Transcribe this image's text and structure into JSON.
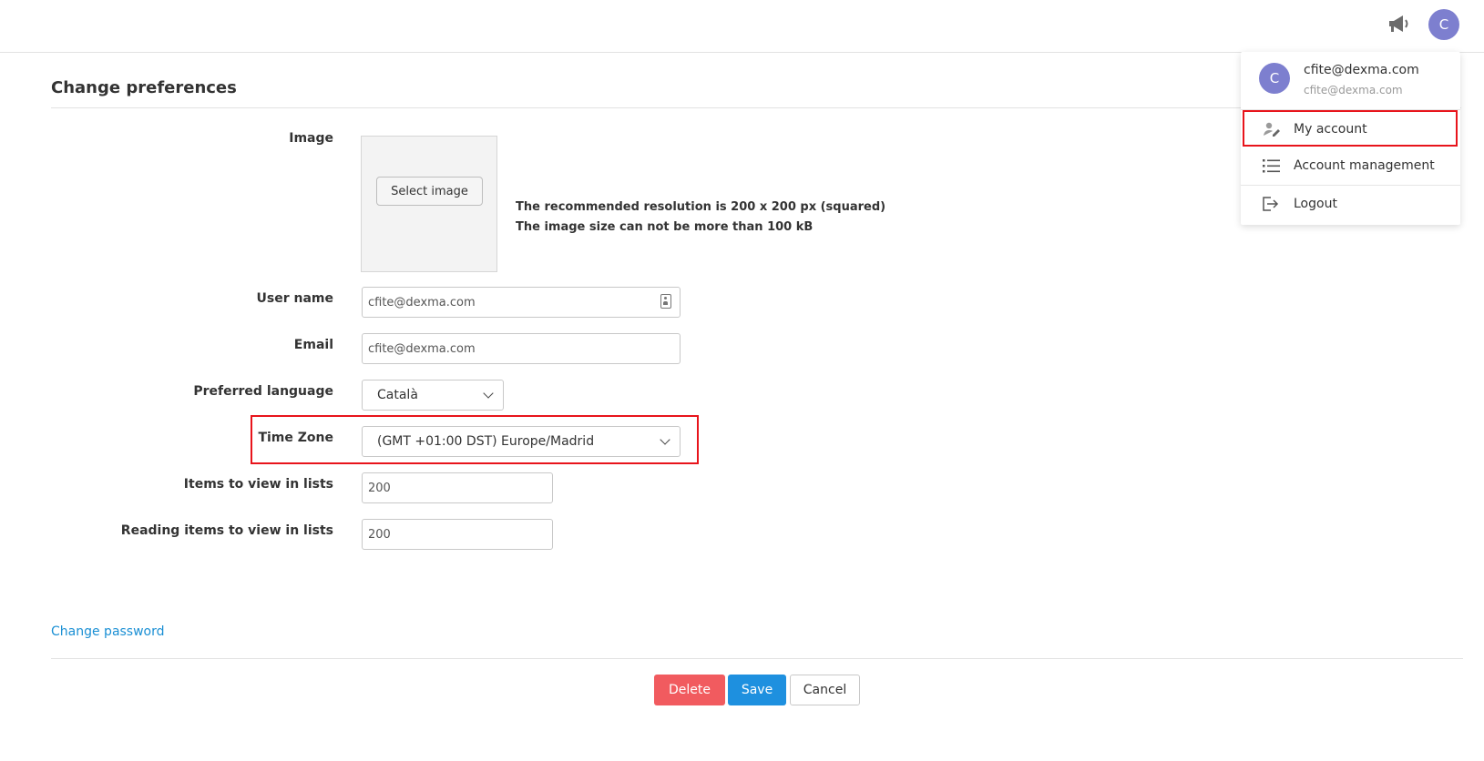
{
  "header": {
    "notifications_icon": "megaphone-icon",
    "avatar_initial": "C"
  },
  "account_menu": {
    "avatar_initial": "C",
    "user_name": "cfite@dexma.com",
    "user_email": "cfite@dexma.com",
    "items": [
      {
        "label": "My account",
        "icon": "user-edit-icon"
      },
      {
        "label": "Account management",
        "icon": "list-icon"
      },
      {
        "label": "Logout",
        "icon": "logout-icon"
      }
    ]
  },
  "page": {
    "title": "Change preferences"
  },
  "form": {
    "image": {
      "label": "Image",
      "button_label": "Select image",
      "hint_resolution": "The recommended resolution is 200 x 200 px (squared)",
      "hint_size": "The image size can not be more than 100 kB"
    },
    "user_name": {
      "label": "User name",
      "value": "cfite@dexma.com"
    },
    "email": {
      "label": "Email",
      "value": "cfite@dexma.com"
    },
    "preferred_language": {
      "label": "Preferred language",
      "value": "Català"
    },
    "time_zone": {
      "label": "Time Zone",
      "value": "(GMT +01:00 DST) Europe/Madrid"
    },
    "items_in_lists": {
      "label": "Items to view in lists",
      "value": "200"
    },
    "reading_items_in_lists": {
      "label": "Reading items to view in lists",
      "value": "200"
    }
  },
  "links": {
    "change_password": "Change password"
  },
  "actions": {
    "delete_label": "Delete",
    "save_label": "Save",
    "cancel_label": "Cancel"
  },
  "colors": {
    "accent_blue": "#1e90df",
    "danger": "#f15b5f",
    "avatar": "#7d7fcf",
    "highlight": "#e8141b",
    "link": "#1a8fd4"
  }
}
